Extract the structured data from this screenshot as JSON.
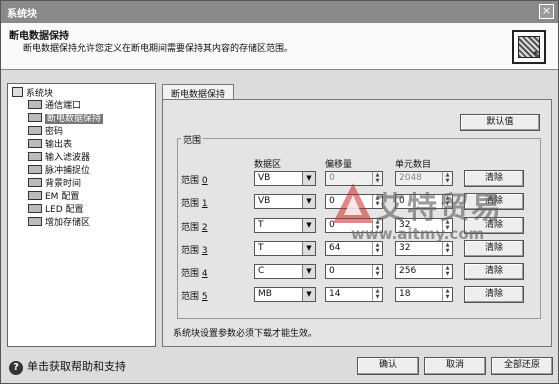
{
  "window": {
    "title": "系统块",
    "close_label": "×"
  },
  "header": {
    "title": "断电数据保持",
    "description": "断电数据保持允许您定义在断电期间需要保持其内容的存储区范围。"
  },
  "tree": {
    "root": "系统块",
    "items": [
      {
        "label": "通信端口",
        "selected": false
      },
      {
        "label": "断电数据保持",
        "selected": true
      },
      {
        "label": "密码",
        "selected": false
      },
      {
        "label": "输出表",
        "selected": false
      },
      {
        "label": "输入滤波器",
        "selected": false
      },
      {
        "label": "脉冲捕捉位",
        "selected": false
      },
      {
        "label": "背景时间",
        "selected": false
      },
      {
        "label": "EM 配置",
        "selected": false
      },
      {
        "label": "LED 配置",
        "selected": false
      },
      {
        "label": "增加存储区",
        "selected": false
      }
    ]
  },
  "tab": {
    "label": "断电数据保持"
  },
  "default_button": "默认值",
  "range_group": {
    "legend": "范围",
    "headers": {
      "area": "数据区",
      "offset": "偏移量",
      "count": "单元数目"
    },
    "rows": [
      {
        "label": "范围",
        "num": "0",
        "area": "VB",
        "offset": "0",
        "count": "2048",
        "clear": "清除"
      },
      {
        "label": "范围",
        "num": "1",
        "area": "VB",
        "offset": "0",
        "count": "0",
        "clear": "清除"
      },
      {
        "label": "范围",
        "num": "2",
        "area": "T",
        "offset": "0",
        "count": "32",
        "clear": "清除"
      },
      {
        "label": "范围",
        "num": "3",
        "area": "T",
        "offset": "64",
        "count": "32",
        "clear": "清除"
      },
      {
        "label": "范围",
        "num": "4",
        "area": "C",
        "offset": "0",
        "count": "256",
        "clear": "清除"
      },
      {
        "label": "范围",
        "num": "5",
        "area": "MB",
        "offset": "14",
        "count": "18",
        "clear": "清除"
      }
    ]
  },
  "note": "系统块设置参数必须下载才能生效。",
  "help": {
    "text": "单击获取帮助和支持",
    "icon": "?"
  },
  "footer": {
    "ok": "确认",
    "cancel": "取消",
    "restore_all": "全部还原"
  },
  "watermark": {
    "text": "艾特贸易",
    "url": "www.aitmy.com",
    "mark": "A"
  }
}
